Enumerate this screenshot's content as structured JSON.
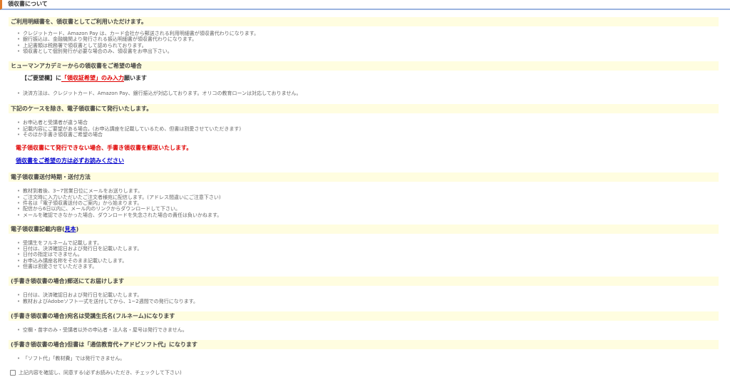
{
  "title": "領収書について",
  "sections": {
    "s1": {
      "heading": "ご利用明細書を、領収書としてご利用いただけます。",
      "items": [
        "クレジットカード、Amazon Pay は、カード会社から郵送される利用明細書が領収書代わりになります。",
        "銀行振込は、金融機関より発行される振込明細書が領収書代わりになります。",
        "上記書類は税務署で領収書として認められております。",
        "領収書として個別発行が必要な場合のみ、領収書をお申出下さい。"
      ]
    },
    "s2": {
      "heading": "ヒューマンアカデミーからの領収書をご希望の場合",
      "request_prefix": "【ご要望欄】に",
      "request_highlight": "「領収証希望」のみ入力",
      "request_suffix": "願います",
      "items": [
        "決済方法は、クレジットカード、Amazon Pay、銀行振込が対応しております。オリコの教育ローンは対応しておりません。"
      ]
    },
    "s3": {
      "heading": "下記のケースを除き、電子領収書にて発行いたします。",
      "items": [
        "お申込者と受講者が違う場合",
        "記載内容にご要望がある場合。(お申込講座を記載しているため、但書は割愛させていただきます)",
        "そのほか手書き領収書ご希望の場合"
      ],
      "notice": "電子領収書にて発行できない場合、手書き領収書を郵送いたします。",
      "notice_link": "領収書をご希望の方は必ずお読みください"
    },
    "s4": {
      "heading": "電子領収書送付時期・送付方法",
      "items": [
        "教材到着後、3~7営業日位にメールをお送りします。",
        "ご注文時に入力いただいたご注文者様宛に配信します。(アドレス間違いにご注意下さい)",
        "件名は「電子領収書送付のご案内」から始まります。",
        "配信から6日以内に、メール内のリンクからダウンロードして下さい。",
        "メールを確認できなかった場合、ダウンロードを失念された場合の責任は負いかねます。"
      ]
    },
    "s5": {
      "heading_prefix": "電子領収書記載内容(",
      "heading_link": "見本",
      "heading_suffix": ")",
      "items": [
        "受講生をフルネームで記載します。",
        "日付は、決済確認日および発行日を記載いたします。",
        "日付の指定はできません。",
        "お申込み講座名称をそのまま記載いたします。",
        "但書は割愛させていただきます。"
      ]
    },
    "s6": {
      "heading": "(手書き領収書の場合)郵送にてお届けします",
      "items": [
        "日付は、決済確認日および発行日を記載いたします。",
        "教材およびAdobeソフト一式を送付してから、1~2週間での発行になります。"
      ]
    },
    "s7": {
      "heading": "(手書き領収書の場合)宛名は受講生氏名(フルネーム)になります",
      "items": [
        "空欄・苗字のみ・受講者以外の申込者・法人名・屋号は発行できません。"
      ]
    },
    "s8": {
      "heading": "(手書き領収書の場合)但書は「通信教育代+アドビソフト代」になります",
      "items": [
        "「ソフト代」「教材費」では発行できません。"
      ]
    }
  },
  "agree": {
    "label": "上記内容を確認し、同意する(必ずお読みいただき、チェックして下さい)",
    "checked": false
  }
}
